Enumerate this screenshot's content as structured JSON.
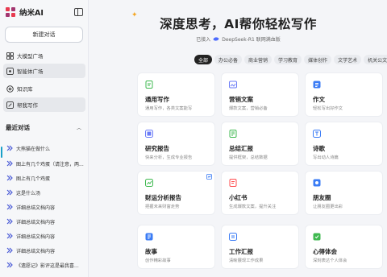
{
  "brand": {
    "name": "纳米AI",
    "icon": "nami-logo-icon"
  },
  "sidebar": {
    "new_chat": "新建对话",
    "nav": [
      {
        "label": "大模型广场",
        "icon": "grid-icon"
      },
      {
        "label": "智能体广场",
        "icon": "agent-icon"
      },
      {
        "label": "知识库",
        "icon": "database-icon"
      },
      {
        "label": "帮我写作",
        "icon": "pen-icon"
      }
    ],
    "recent_title": "最近对话",
    "history": [
      {
        "label": "大熊猫在做什么",
        "icon": "chat-bubble-icon"
      },
      {
        "label": "图上有几个鸡蛋（请注意，两...",
        "icon": "chat-bubble-icon"
      },
      {
        "label": "图上有几个鸡蛋",
        "icon": "chat-bubble-icon"
      },
      {
        "label": "这是什么汤",
        "icon": "chat-bubble-icon"
      },
      {
        "label": "详细总结文档内容",
        "icon": "chat-bubble-icon"
      },
      {
        "label": "详细总结文档内容",
        "icon": "chat-bubble-icon"
      },
      {
        "label": "详细总结文档内容",
        "icon": "chat-bubble-icon"
      },
      {
        "label": "详细总结文档内容",
        "icon": "chat-bubble-icon"
      },
      {
        "label": "《遗愿记》影评这是最我喜...",
        "icon": "chat-bubble-icon"
      }
    ]
  },
  "main": {
    "title": "深度思考，AI帮你轻松写作",
    "subtitle_prefix": "已接入",
    "subtitle_model": "DeepSeek-R1 联网满血版",
    "tabs": [
      {
        "label": "全部"
      },
      {
        "label": "办公必备"
      },
      {
        "label": "商业营销"
      },
      {
        "label": "学习教育"
      },
      {
        "label": "媒体创作"
      },
      {
        "label": "文学艺术"
      },
      {
        "label": "机关公文"
      }
    ],
    "cards": [
      {
        "title": "通用写作",
        "desc": "通用写作，各类文案能写",
        "icon": "document-icon",
        "icon_color": "#3fb950"
      },
      {
        "title": "营销文案",
        "desc": "爆款文案，营销必备",
        "icon": "image-card-icon",
        "icon_color": "#6b7cf7"
      },
      {
        "title": "作文",
        "desc": "轻松写出好作文",
        "icon": "composition-icon",
        "icon_color": "#3b7cf5"
      },
      {
        "title": "研究报告",
        "desc": "快来分析，生成专业报告",
        "icon": "research-icon",
        "icon_color": "#6b7cf7"
      },
      {
        "title": "总结汇报",
        "desc": "提供框架，总结数据",
        "icon": "summary-icon",
        "icon_color": "#3fb950"
      },
      {
        "title": "诗歌",
        "desc": "写出动人诗篇",
        "icon": "poem-icon",
        "icon_color": "#3b7cf5"
      },
      {
        "title": "财运分析报告",
        "desc": "把握未来财富走势",
        "icon": "finance-icon",
        "icon_color": "#3fb950"
      },
      {
        "title": "小红书",
        "desc": "生成爆款文案，提升关注",
        "icon": "book-icon",
        "icon_color": "#ff4d4f"
      },
      {
        "title": "朋友圈",
        "desc": "让朋友圈更出彩",
        "icon": "moments-icon",
        "icon_color": "#3b7cf5"
      },
      {
        "title": "故事",
        "desc": "创作精彩故事",
        "icon": "story-icon",
        "icon_color": "#3b7cf5"
      },
      {
        "title": "工作汇报",
        "desc": "清晰展现工作成果",
        "icon": "work-report-icon",
        "icon_color": "#3b7cf5"
      },
      {
        "title": "心得体会",
        "desc": "深刻表达个人体会",
        "icon": "reflection-icon",
        "icon_color": "#3fb950"
      }
    ]
  }
}
